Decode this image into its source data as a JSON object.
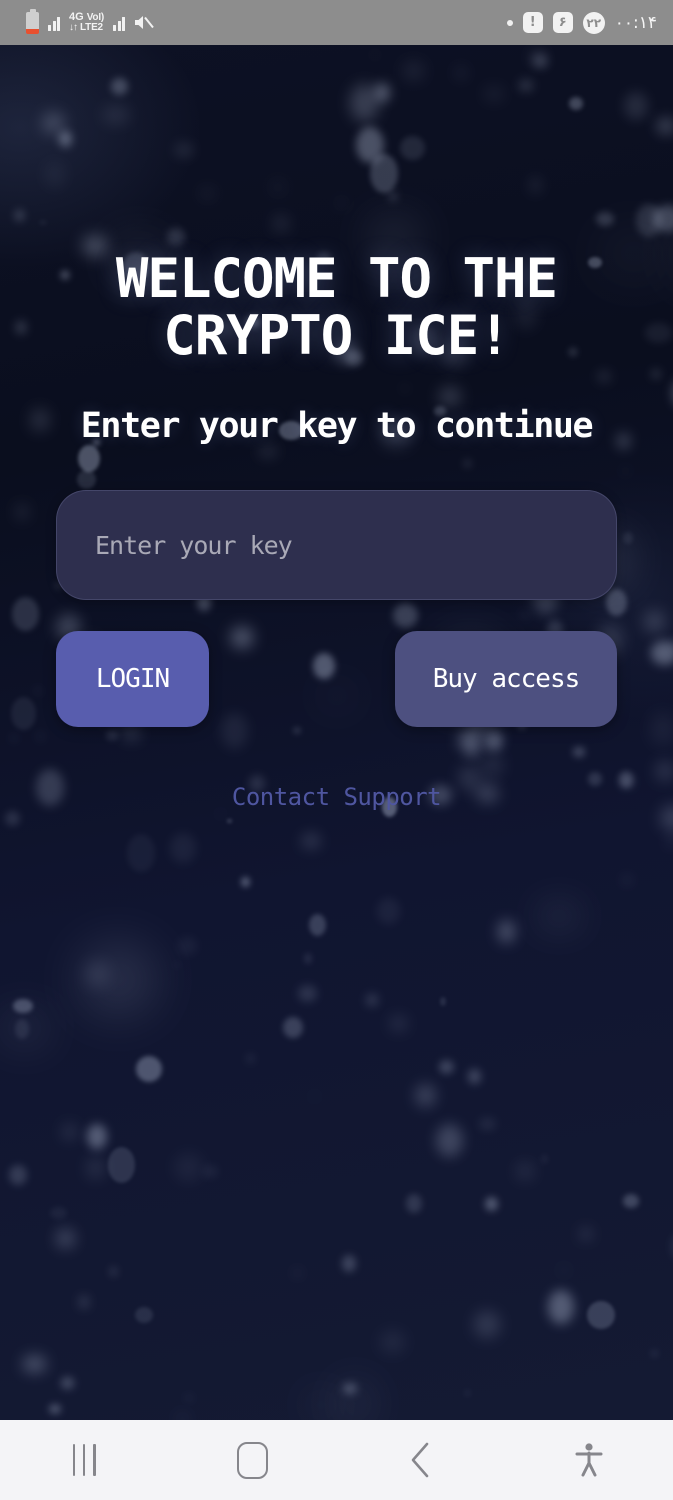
{
  "status_bar": {
    "battery_icon": "battery-low-icon",
    "signal_icon_1": "signal-bars-icon",
    "network_type": "4G",
    "data_arrows": "↓↑",
    "voice_label": "VoI)",
    "network_sub": "LTE2",
    "signal_icon_2": "signal-bars-icon",
    "mute_icon": "volume-muted-icon",
    "dot_indicator": "dot-icon",
    "alert_badge": "!",
    "count_badge_1": "۶",
    "count_badge_2": "۲۲",
    "time": "۰۰:۱۴"
  },
  "app": {
    "title": "WELCOME TO THE\nCRYPTO ICE!",
    "subtitle": "Enter your key to continue",
    "key_input": {
      "placeholder": "Enter your key",
      "value": ""
    },
    "login_label": "LOGIN",
    "buy_access_label": "Buy access",
    "contact_support_label": "Contact Support",
    "colors": {
      "background_top": "#0d1124",
      "background_bottom": "#141a33",
      "input_fill": "#2e2f4e",
      "login_button": "#585dae",
      "buy_button": "#4d5080",
      "support_link": "#4f56a0",
      "title_text": "#ffffff"
    }
  },
  "nav_bar": {
    "recents_icon": "recents-icon",
    "home_icon": "home-icon",
    "back_icon": "back-chevron-icon",
    "accessibility_icon": "accessibility-person-icon"
  }
}
